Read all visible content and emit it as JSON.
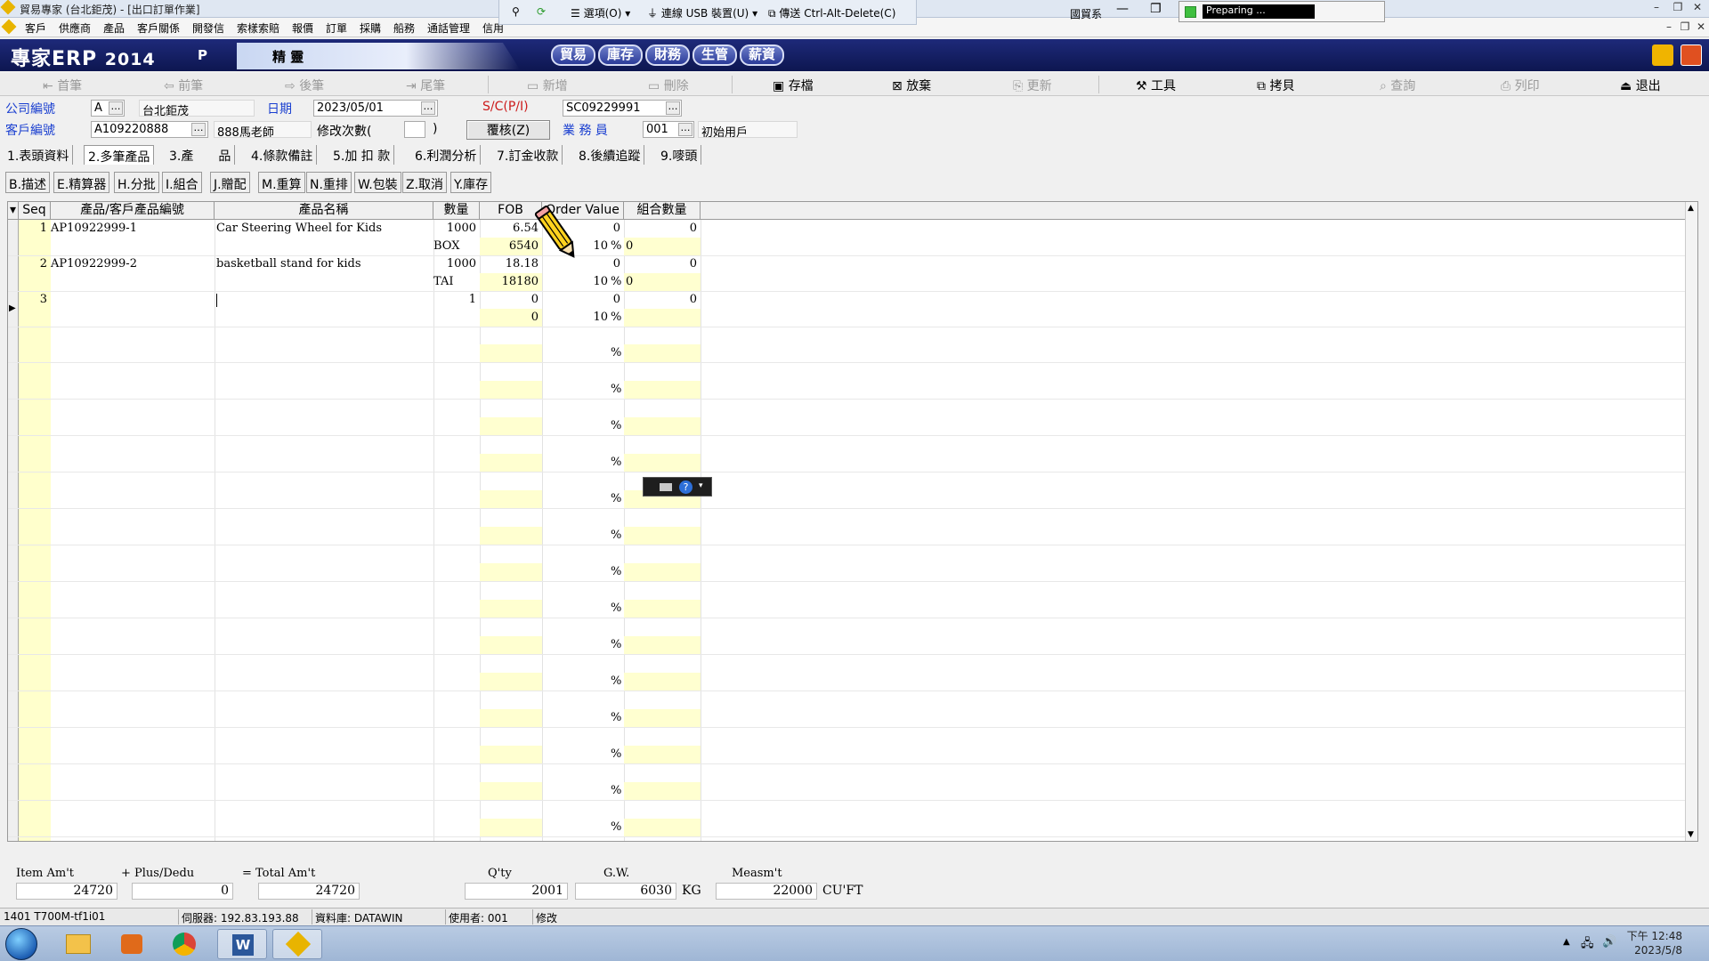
{
  "window": {
    "title": "貿易專家 (台北鉅茂) - [出口訂單作業]",
    "menu": [
      "客戶",
      "供應商",
      "產品",
      "客戶關係",
      "開發信",
      "索樣索賠",
      "報價",
      "訂單",
      "採購",
      "船務",
      "通話管理",
      "信用"
    ]
  },
  "remote_bar": {
    "options": "選項(O)",
    "usb": "連線 USB 裝置(U)",
    "cad": "傳送 Ctrl-Alt-Delete(C)",
    "user": "國貿系",
    "progress_text": "Preparing ..."
  },
  "banner": {
    "app_name": "專家ERP",
    "year": "2014",
    "p_label": "P",
    "edition": "精 靈",
    "modules": [
      "貿易",
      "庫存",
      "財務",
      "生管",
      "薪資"
    ]
  },
  "toolbar": {
    "first": "首筆",
    "prev": "前筆",
    "next": "後筆",
    "last": "尾筆",
    "new": "新增",
    "delete": "刪除",
    "save": "存檔",
    "discard": "放棄",
    "update": "更新",
    "tools": "工具",
    "copy": "拷貝",
    "query": "查詢",
    "print": "列印",
    "exit": "退出"
  },
  "header": {
    "company_label": "公司編號",
    "company_code": "A",
    "company_name": "台北鉅茂",
    "date_label": "日期",
    "date_value": "2023/05/01",
    "sc_label": "S/C(P/I)",
    "sc_value": "SC09229991",
    "customer_label": "客戶編號",
    "customer_code": "A109220888",
    "customer_name": "888馬老師",
    "revision_label": "修改次數(",
    "revision_close": ")",
    "review_button": "覆核(Z)",
    "salesman_label": "業 務 員",
    "salesman_code": "001",
    "salesman_name": "初始用戶"
  },
  "tabs": [
    "1.表頭資料",
    "2.多筆產品",
    "3.產　　品",
    "4.條款備註",
    "5.加 扣 款",
    "6.利潤分析",
    "7.訂金收款",
    "8.後續追蹤",
    "9.嘜頭"
  ],
  "active_tab": "2.多筆產品",
  "subtabs": [
    "B.描述",
    "E.精算器",
    "H.分批",
    "I.組合",
    "J.贈配",
    "M.重算",
    "N.重排",
    "W.包裝",
    "Z.取消",
    "Y.庫存"
  ],
  "grid": {
    "columns": [
      "Seq",
      "產品/客戶產品編號",
      "產品名稱",
      "數量",
      "FOB",
      "Order Value",
      "組合數量"
    ],
    "rows": [
      {
        "seq": "1",
        "code": "AP10922999-1",
        "name": "Car Steering Wheel for Kids",
        "qty": "1000",
        "fob": "6.54",
        "order_value": "0",
        "combo_qty": "0",
        "unit": "BOX",
        "amount": "6540",
        "pct": "10",
        "pct_suffix": "%",
        "pct_extra": "0"
      },
      {
        "seq": "2",
        "code": "AP10922999-2",
        "name": "basketball stand for kids",
        "qty": "1000",
        "fob": "18.18",
        "order_value": "0",
        "combo_qty": "0",
        "unit": "TAI",
        "amount": "18180",
        "pct": "10",
        "pct_suffix": "%",
        "pct_extra": "0"
      },
      {
        "seq": "3",
        "code": "",
        "name": "",
        "qty": "1",
        "fob": "0",
        "order_value": "0",
        "combo_qty": "0",
        "unit": "",
        "amount": "0",
        "pct": "10",
        "pct_suffix": "%",
        "pct_extra": ""
      }
    ],
    "empty_row_pct": "%"
  },
  "totals": {
    "item_amt_label": "Item Am't",
    "plus_dedu_label": "+ Plus/Dedu",
    "total_amt_label": "= Total Am't",
    "qty_label": "Q'ty",
    "gw_label": "G.W.",
    "measmt_label": "Measm't",
    "item_amt": "24720",
    "plus_dedu": "0",
    "total_amt": "24720",
    "qty": "2001",
    "gw": "6030",
    "gw_unit": "KG",
    "measmt": "22000",
    "measmt_unit": "CU'FT"
  },
  "status_bar": {
    "terminal": "1401 T700M-tf1i01",
    "server": "伺服器: 192.83.193.88",
    "database": "資料庫: DATAWIN",
    "user": "使用者: 001",
    "mode": "修改"
  },
  "taskbar": {
    "time": "下午 12:48",
    "date": "2023/5/8"
  }
}
